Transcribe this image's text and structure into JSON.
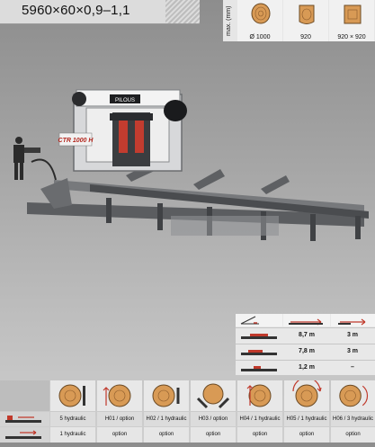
{
  "title": "5960×60×0,9–1,1",
  "log_panel": {
    "max_label": "max. (mm)",
    "sizes": [
      {
        "icon": "round-log-icon",
        "value": "Ø 1000"
      },
      {
        "icon": "slab-log-icon",
        "value": "920"
      },
      {
        "icon": "square-log-icon",
        "value": "920 × 920"
      }
    ]
  },
  "machine": {
    "brand": "PILOUS",
    "model": "CTR 1000 H"
  },
  "spec_table": {
    "header_icons": [
      "angle-icon",
      "length-arrow-icon",
      "extension-arrow-icon"
    ],
    "rows": [
      {
        "icon": "section-icon",
        "length": "8,7 m",
        "extension": "3 m"
      },
      {
        "icon": "section-icon",
        "length": "7,8 m",
        "extension": "3 m"
      },
      {
        "icon": "section-icon",
        "length": "1,2 m",
        "extension": "–"
      }
    ]
  },
  "options": {
    "row_icons": [
      "hydraulic-row-icon",
      "option-row-icon"
    ],
    "columns": [
      {
        "icon": "log-clamp-icon",
        "row1": "5 hydraulic",
        "row2": "1 hydraulic"
      },
      {
        "icon": "log-lift-icon",
        "row1": "H01 / option",
        "row2": "option"
      },
      {
        "icon": "log-stop-icon",
        "row1": "H02 / 1 hydraulic",
        "row2": "option"
      },
      {
        "icon": "log-support-icon",
        "row1": "H03 / option",
        "row2": "option"
      },
      {
        "icon": "log-turn-icon",
        "row1": "H04 / 1 hydraulic",
        "row2": "option"
      },
      {
        "icon": "log-rotate-icon",
        "row1": "H05 / 1 hydraulic",
        "row2": "option"
      },
      {
        "icon": "log-grip-icon",
        "row1": "H06 / 3 hydraulic",
        "row2": "option"
      }
    ]
  }
}
